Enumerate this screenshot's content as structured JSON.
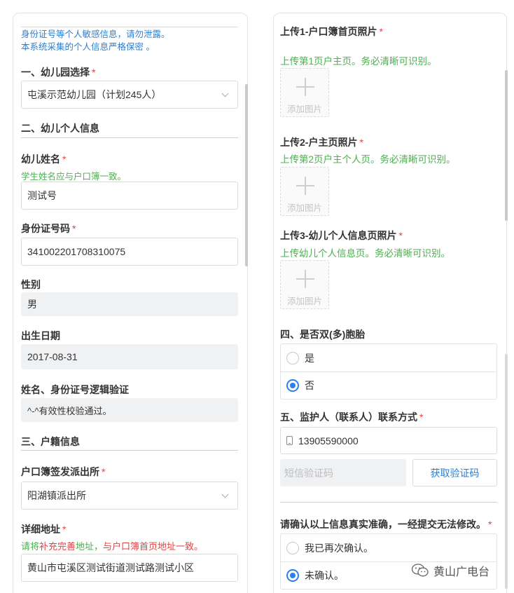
{
  "left": {
    "notice_line1": "身份证号等个人敏感信息，请勿泄露。",
    "notice_line2": "本系统采集的个人信息严格保密 。",
    "section1_title": "一、幼儿园选择",
    "kindergarten_select": "屯溪示范幼儿园（计划245人）",
    "section2_title": "二、幼儿个人信息",
    "child_name_label": "幼儿姓名",
    "child_name_hint": "学生姓名应与户口簿一致。",
    "child_name_value": "测试号",
    "id_label": "身份证号码",
    "id_value": "341002201708310075",
    "gender_label": "性别",
    "gender_value": "男",
    "birth_label": "出生日期",
    "birth_value": "2017-08-31",
    "verify_label": "姓名、身份证号逻辑验证",
    "verify_value": "^-^有效性校验通过。",
    "section3_title": "三、户籍信息",
    "police_label": "户口簿签发派出所",
    "police_value": "阳湖镇派出所",
    "address_label": "详细地址",
    "address_hint_1": "请将",
    "address_hint_2": "补充完善",
    "address_hint_3": "地址，",
    "address_hint_4": "与户口簿首页地址一致。",
    "address_value": "黄山市屯溪区测试街道测试路测试小区"
  },
  "right": {
    "upload1_label": "上传1-户口簿首页照片",
    "upload1_hint": "上传第1页户主页。务必清晰可识别。",
    "upload2_label": "上传2-户主页照片",
    "upload2_hint": "上传第2页户主个人页。务必清晰可识别。",
    "upload3_label": "上传3-幼儿个人信息页照片",
    "upload3_hint": "上传幼儿个人信息页。务必清晰可识别。",
    "add_image": "添加图片",
    "section4_title": "四、是否双(多)胞胎",
    "twins_yes": "是",
    "twins_no": "否",
    "section5_title": "五、监护人（联系人）联系方式",
    "phone_value": "13905590000",
    "sms_placeholder": "短信验证码",
    "sms_button": "获取验证码",
    "confirm_title": "请确认以上信息真实准确，一经提交无法修改。",
    "confirm_yes": "我已再次确认。",
    "confirm_no": "未确认。"
  },
  "required_mark": "*",
  "watermark": "黄山广电台",
  "colors": {
    "accent": "#2d7ff0",
    "notice_blue": "#2b7fd2",
    "hint_green": "#4caf50",
    "required_red": "#e04242"
  }
}
